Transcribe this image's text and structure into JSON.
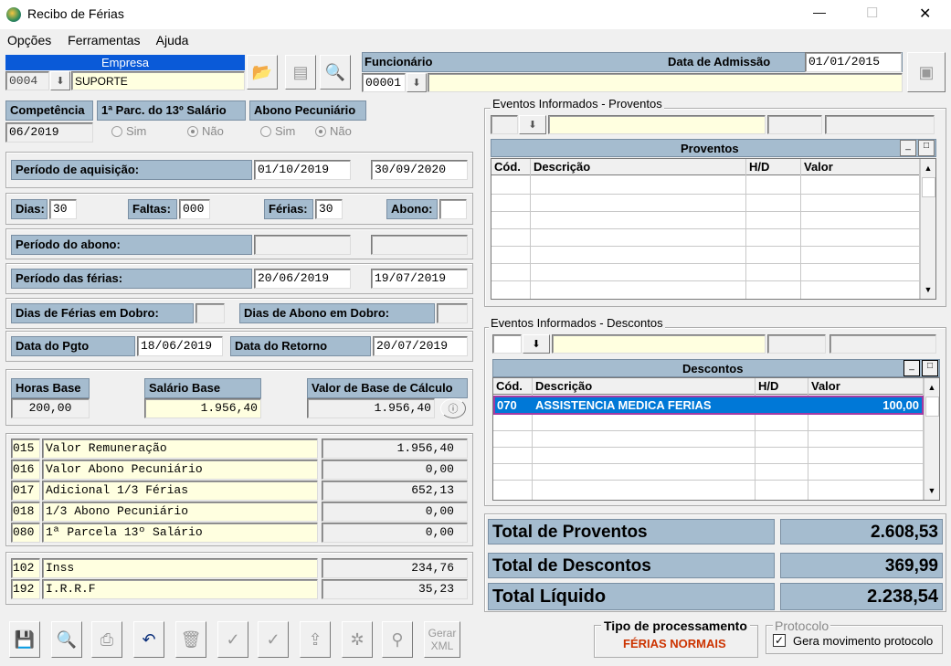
{
  "window": {
    "title": "Recibo de Férias",
    "minimize": "—",
    "maximize": "☐",
    "close": "✕"
  },
  "menu": [
    "Opções",
    "Ferramentas",
    "Ajuda"
  ],
  "empresa": {
    "label": "Empresa",
    "code": "0004",
    "name": "SUPORTE"
  },
  "funcionario": {
    "label": "Funcionário",
    "code": "00001",
    "name": "",
    "admissao_label": "Data de Admissão",
    "admissao": "01/01/2015"
  },
  "competencia": {
    "label": "Competência",
    "value": "06/2019"
  },
  "parc13": {
    "label": "1ª Parc. do 13º Salário",
    "sim": "Sim",
    "nao": "Não"
  },
  "abono_pec": {
    "label": "Abono Pecuniário",
    "sim": "Sim",
    "nao": "Não"
  },
  "periodo_aquisicao": {
    "label": "Período de aquisição:",
    "inicio": "01/10/2019",
    "fim": "30/09/2020"
  },
  "dias": {
    "label": "Dias:",
    "value": "30",
    "faltas_label": "Faltas:",
    "faltas": "000",
    "ferias_label": "Férias:",
    "ferias": "30",
    "abono_label": "Abono:",
    "abono": ""
  },
  "periodo_abono": {
    "label": "Período do abono:",
    "inicio": "",
    "fim": ""
  },
  "periodo_ferias": {
    "label": "Período das férias:",
    "inicio": "20/06/2019",
    "fim": "19/07/2019"
  },
  "dobro": {
    "ferias_label": "Dias de Férias em Dobro:",
    "ferias": "",
    "abono_label": "Dias de Abono em Dobro:",
    "abono": ""
  },
  "pgto": {
    "label": "Data do Pgto",
    "value": "18/06/2019",
    "retorno_label": "Data do Retorno",
    "retorno": "20/07/2019"
  },
  "bases": {
    "horas_label": "Horas Base",
    "horas": "200,00",
    "salario_label": "Salário Base",
    "salario": "1.956,40",
    "calculo_label": "Valor de Base de Cálculo",
    "calculo": "1.956,40"
  },
  "verbas": [
    {
      "code": "015",
      "desc": "Valor Remuneração",
      "value": "1.956,40"
    },
    {
      "code": "016",
      "desc": "Valor Abono Pecuniário",
      "value": "0,00"
    },
    {
      "code": "017",
      "desc": "Adicional 1/3 Férias",
      "value": "652,13"
    },
    {
      "code": "018",
      "desc": "1/3 Abono Pecuniário",
      "value": "0,00"
    },
    {
      "code": "080",
      "desc": "1ª Parcela 13º Salário",
      "value": "0,00"
    }
  ],
  "descontos_calc": [
    {
      "code": "102",
      "desc": "Inss",
      "value": "234,76"
    },
    {
      "code": "192",
      "desc": "I.R.R.F",
      "value": "35,23"
    }
  ],
  "eventos_proventos": {
    "group_label": "Eventos Informados - Proventos",
    "grid_title": "Proventos",
    "cols": [
      "Cód.",
      "Descrição",
      "H/D",
      "Valor"
    ]
  },
  "eventos_descontos": {
    "group_label": "Eventos Informados - Descontos",
    "grid_title": "Descontos",
    "cols": [
      "Cód.",
      "Descrição",
      "H/D",
      "Valor"
    ],
    "rows": [
      {
        "code": "070",
        "desc": "ASSISTENCIA MEDICA FERIAS",
        "hd": "",
        "value": "100,00"
      }
    ]
  },
  "totais": {
    "proventos_label": "Total de Proventos",
    "proventos": "2.608,53",
    "descontos_label": "Total de Descontos",
    "descontos": "369,99",
    "liquido_label": "Total Líquido",
    "liquido": "2.238,54"
  },
  "processamento": {
    "label": "Tipo de processamento",
    "value": "FÉRIAS NORMAIS"
  },
  "protocolo": {
    "label": "Protocolo",
    "checkbox_label": "Gera movimento protocolo",
    "checked": true
  },
  "toolbar": {
    "gerar_xml": "Gerar XML"
  },
  "colors": {
    "label_bg": "#a5bccf",
    "field_yellow": "#ffffe0",
    "selection": "#0078d7",
    "accent_red": "#cc3300"
  }
}
